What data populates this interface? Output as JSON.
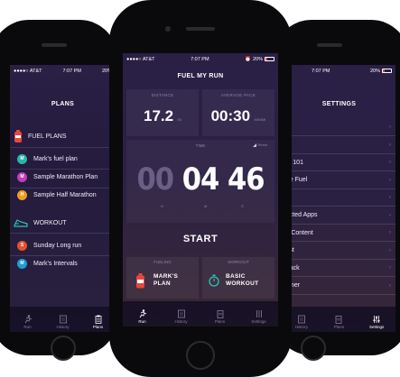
{
  "status_bar": {
    "carrier": "●●●●○ AT&T",
    "time": "7:07 PM",
    "battery": "20%"
  },
  "left_phone": {
    "title": "PLANS",
    "fuel_section": "FUEL PLANS",
    "fuel_plans": [
      {
        "initial": "M",
        "label": "Mark's fuel plan",
        "color": "#29b6a8"
      },
      {
        "initial": "M",
        "label": "Sample Marathon Plan",
        "color": "#c03fb5"
      },
      {
        "initial": "H",
        "label": "Sample Half Marathon",
        "color": "#e8a020"
      }
    ],
    "workout_section": "WORKOUT",
    "workouts": [
      {
        "initial": "S",
        "label": "Sunday Long run",
        "color": "#e3532e"
      },
      {
        "initial": "M",
        "label": "Mark's Intervals",
        "color": "#1e9ed8"
      }
    ],
    "tabs": [
      "Run",
      "History",
      "Plans"
    ]
  },
  "center_phone": {
    "title": "FUEL MY RUN",
    "distance_label": "DISTANCE",
    "distance_value": "17.2",
    "distance_unit": "MI",
    "pace_label": "AVERAGE PACE",
    "pace_value": "00:30",
    "pace_unit": "MIN/MI",
    "time_label": "TIME",
    "time_toggle": "Reset",
    "hours": "00",
    "minutes": "04",
    "seconds": "46",
    "h_label": "H",
    "m_label": "M",
    "s_label": "S",
    "start_label": "START",
    "fueling_label": "FUELING",
    "fueling_plan": "MARK'S PLAN",
    "workout_label": "WORKOUT",
    "workout_plan": "BASIC WORKOUT",
    "tabs": [
      "Run",
      "History",
      "Plans",
      "Settings"
    ]
  },
  "right_phone": {
    "title": "SETTINGS",
    "items": [
      "out",
      "ile",
      "ing 101",
      "age Fuel",
      "",
      "nected Apps",
      "us Content",
      "cast",
      "dback",
      "laimer"
    ],
    "tabs": [
      "History",
      "Plans",
      "Settings"
    ]
  },
  "colors": {
    "bg_dark": "#1c1530",
    "accent_red": "#e8463f",
    "accent_teal": "#2ec4b6"
  }
}
